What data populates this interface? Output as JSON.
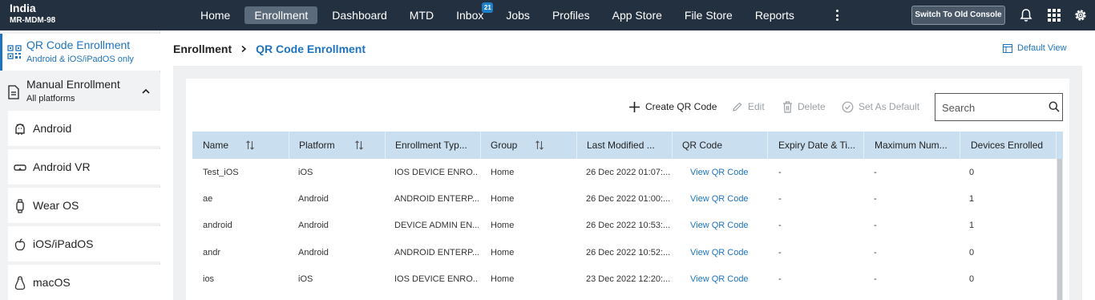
{
  "org": {
    "name": "India",
    "id": "MR-MDM-98"
  },
  "nav": {
    "items": [
      {
        "label": "Home"
      },
      {
        "label": "Enrollment",
        "active": true
      },
      {
        "label": "Dashboard"
      },
      {
        "label": "MTD"
      },
      {
        "label": "Inbox",
        "badge": "21"
      },
      {
        "label": "Jobs"
      },
      {
        "label": "Profiles"
      },
      {
        "label": "App Store"
      },
      {
        "label": "File Store"
      },
      {
        "label": "Reports"
      }
    ],
    "switch_console": "Switch To Old Console",
    "icons": [
      "more-vertical-icon",
      "bell-icon",
      "apps-grid-icon",
      "gear-icon"
    ]
  },
  "sidebar": {
    "active": {
      "title": "QR Code Enrollment",
      "subtitle": "Android & iOS/iPadOS only",
      "icon": "qr-code-icon"
    },
    "group": {
      "title": "Manual Enrollment",
      "subtitle": "All platforms",
      "icon": "document-icon"
    },
    "items": [
      {
        "label": "Android",
        "icon": "android-icon"
      },
      {
        "label": "Android VR",
        "icon": "vr-headset-icon"
      },
      {
        "label": "Wear OS",
        "icon": "smartwatch-icon"
      },
      {
        "label": "iOS/iPadOS",
        "icon": "apple-icon"
      },
      {
        "label": "macOS",
        "icon": "linux-penguin-icon"
      }
    ]
  },
  "breadcrumb": {
    "parent": "Enrollment",
    "current": "QR Code Enrollment"
  },
  "default_view": "Default View",
  "toolbar": {
    "create": "Create QR Code",
    "edit": "Edit",
    "delete": "Delete",
    "set_default": "Set As Default"
  },
  "search": {
    "placeholder": "Search",
    "value": ""
  },
  "table": {
    "columns": [
      {
        "label": "Name",
        "sortable": true
      },
      {
        "label": "Platform",
        "sortable": true
      },
      {
        "label": "Enrollment Typ...",
        "sortable": false
      },
      {
        "label": "Group",
        "sortable": true
      },
      {
        "label": "Last Modified ...",
        "sortable": false
      },
      {
        "label": "QR Code",
        "sortable": false
      },
      {
        "label": "Expiry Date & Ti...",
        "sortable": false
      },
      {
        "label": "Maximum Num...",
        "sortable": false
      },
      {
        "label": "Devices Enrolled",
        "sortable": false
      }
    ],
    "rows": [
      [
        "Test_iOS",
        "iOS",
        "IOS DEVICE ENRO...",
        "Home",
        "26 Dec 2022 01:07:...",
        "View QR Code",
        "-",
        "-",
        "0"
      ],
      [
        "ae",
        "Android",
        "ANDROID ENTERP...",
        "Home",
        "26 Dec 2022 01:00:...",
        "View QR Code",
        "-",
        "-",
        "1"
      ],
      [
        "android",
        "Android",
        "DEVICE ADMIN EN...",
        "Home",
        "26 Dec 2022 10:53:...",
        "View QR Code",
        "-",
        "-",
        "1"
      ],
      [
        "andr",
        "Android",
        "ANDROID ENTERP...",
        "Home",
        "26 Dec 2022 10:52:...",
        "View QR Code",
        "-",
        "-",
        "0"
      ],
      [
        "ios",
        "iOS",
        "IOS DEVICE ENRO...",
        "Home",
        "23 Dec 2022 12:20:...",
        "View QR Code",
        "-",
        "-",
        "0"
      ]
    ]
  },
  "colors": {
    "topbar": "#233040",
    "accent": "#1e73be",
    "header_row": "#c9dff0"
  }
}
